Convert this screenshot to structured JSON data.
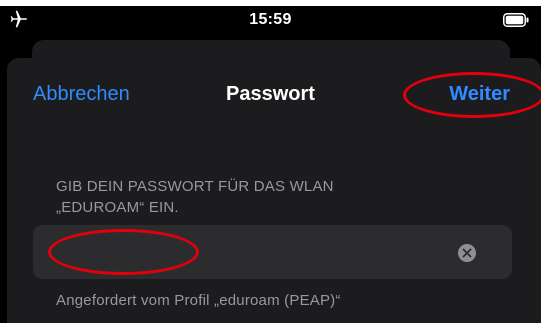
{
  "status_bar": {
    "time": "15:59",
    "airplane_icon": "airplane-icon",
    "battery_icon": "battery-icon"
  },
  "nav": {
    "cancel_label": "Abbrechen",
    "title": "Passwort",
    "next_label": "Weiter"
  },
  "form": {
    "prompt_line1": "GIB DEIN PASSWORT FÜR DAS WLAN",
    "prompt_line2": "„EDUROAM“ EIN.",
    "password_value": "",
    "clear_icon": "clear-icon",
    "footer": "Angefordert vom Profil „eduroam (PEAP)“"
  },
  "colors": {
    "background": "#000000",
    "sheet": "#1c1c1e",
    "field": "#2c2c2e",
    "accent": "#2f8bff",
    "annotation": "#e3000b"
  }
}
